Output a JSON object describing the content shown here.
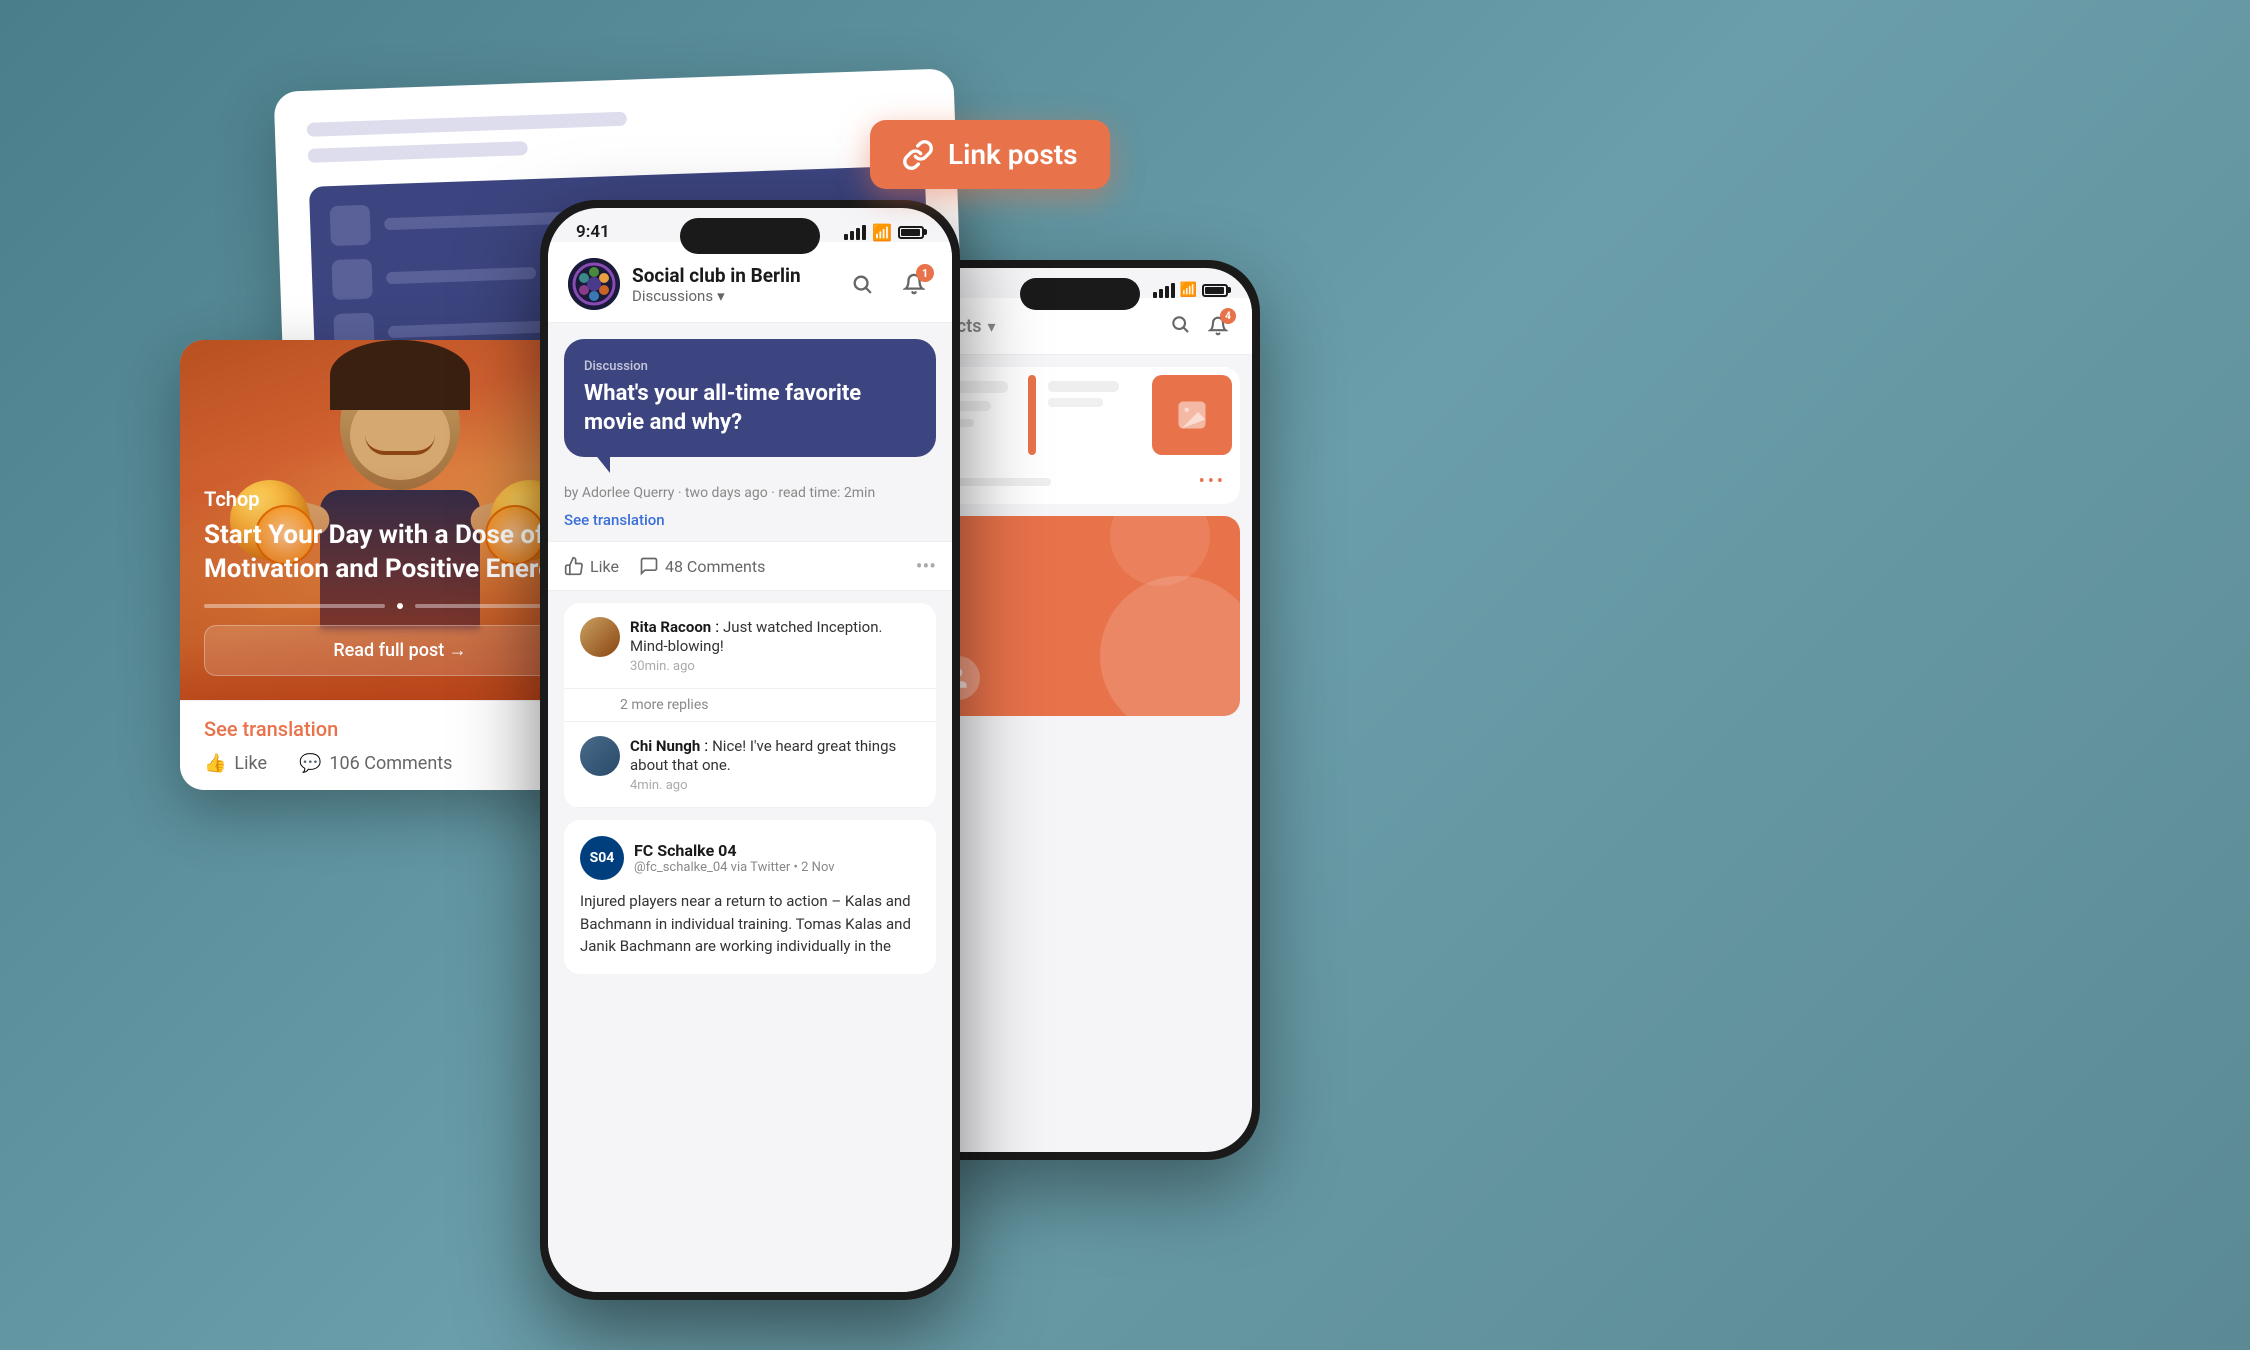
{
  "background": {
    "color": "#5b8a94"
  },
  "link_posts_badge": {
    "label": "Link posts",
    "icon": "link-icon"
  },
  "back_card": {
    "line1_label": "decorative line 1",
    "line2_label": "decorative line 2"
  },
  "left_card": {
    "author": "Tchop",
    "title": "Start Your Day with a Dose of Motivation and Positive Energy!",
    "read_btn": "Read full post →",
    "see_translation": "See translation",
    "like_label": "Like",
    "comments_count": "106 Comments"
  },
  "center_phone": {
    "status_time": "9:41",
    "community_name": "Social club in Berlin",
    "community_sub": "Discussions",
    "search_icon": "search-icon",
    "notification_count": "1",
    "discussion": {
      "label": "Discussion",
      "title": "What's your all-time favorite movie and why?"
    },
    "post_meta": "by Adorlee Querry · two days ago · read time: 2min",
    "see_translation": "See translation",
    "like_label": "Like",
    "comments_count": "48 Comments",
    "comments": [
      {
        "author": "Rita Racoon",
        "text": "Just watched Inception. Mind-blowing!",
        "time": "30min. ago",
        "avatar_color": "#c8a060"
      },
      {
        "author": "Chi Nungh",
        "text": "Nice! I've heard great things about that one.",
        "time": "4min. ago",
        "avatar_color": "#4a6a8a"
      }
    ],
    "more_replies": "2 more replies",
    "schalke": {
      "name": "FC Schalke 04",
      "handle": "@fc_schalke_04 via Twitter • 2 Nov",
      "text": "Injured players near a return to action – Kalas and Bachmann in individual training. Tomas Kalas and Janik Bachmann are working individually in the"
    }
  },
  "right_phone": {
    "notification_count": "4",
    "title_partial": "g facts",
    "chevron": "▾"
  }
}
